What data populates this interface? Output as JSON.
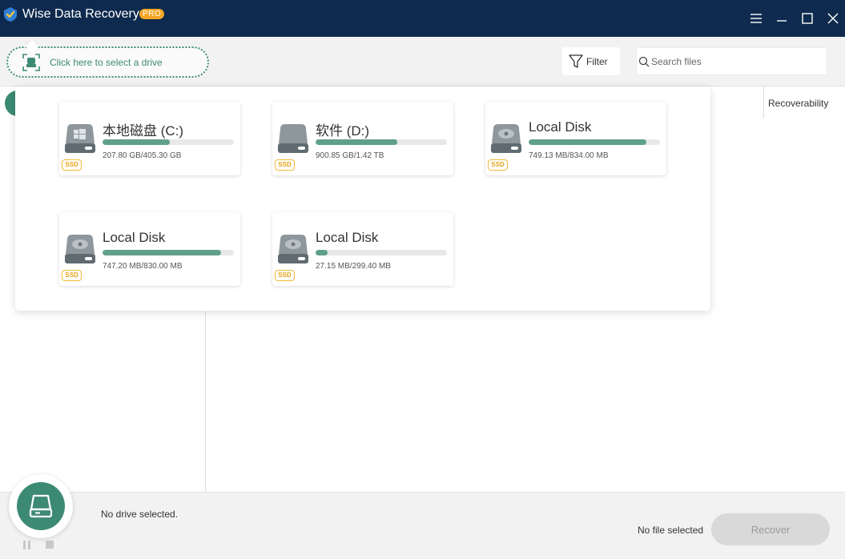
{
  "app": {
    "title": "Wise Data Recovery",
    "badge": "PRO",
    "colors": {
      "titlebar": "#0e2a4e",
      "accent": "#3d8a74",
      "badge": "#f5a623",
      "usage_bar": "#5fa08a"
    }
  },
  "window_controls": [
    "menu-icon",
    "minimize-icon",
    "maximize-icon",
    "close-icon"
  ],
  "toolbar": {
    "drive_select_label": "Click here to select a drive",
    "filter_label": "Filter",
    "search_placeholder": "Search files",
    "search_value": ""
  },
  "table": {
    "columns": [
      "Recoverability"
    ]
  },
  "drives": [
    {
      "name": "本地磁盘 (C:)",
      "size_text": "207.80 GB/405.30 GB",
      "used_fraction": 0.513,
      "type_badge": "SSD",
      "icon": "windows-drive-icon"
    },
    {
      "name": "软件 (D:)",
      "size_text": "900.85 GB/1.42 TB",
      "used_fraction": 0.62,
      "type_badge": "SSD",
      "icon": "hard-drive-icon"
    },
    {
      "name": "Local Disk",
      "size_text": "749.13 MB/834.00 MB",
      "used_fraction": 0.898,
      "type_badge": "SSD",
      "icon": "hard-drive-icon"
    },
    {
      "name": "Local Disk",
      "size_text": "747.20 MB/830.00 MB",
      "used_fraction": 0.9,
      "type_badge": "SSD",
      "icon": "hard-drive-icon"
    },
    {
      "name": "Local Disk",
      "size_text": "27.15 MB/299.40 MB",
      "used_fraction": 0.091,
      "type_badge": "SSD",
      "icon": "hard-drive-icon"
    }
  ],
  "status": {
    "drive_status": "No drive selected.",
    "file_status": "No file selected",
    "recover_label": "Recover"
  }
}
